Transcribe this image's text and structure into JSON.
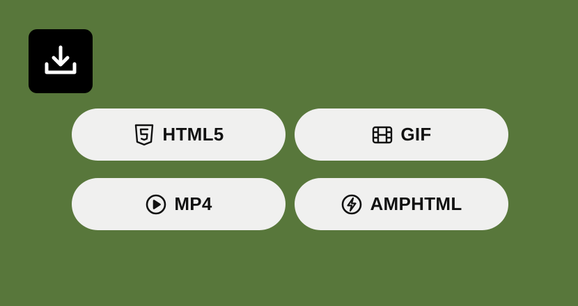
{
  "background_color": "#58773b",
  "download": {
    "icon": "download-icon",
    "tile_color": "#000000"
  },
  "formats": [
    {
      "label": "HTML5",
      "icon": "html5-icon"
    },
    {
      "label": "GIF",
      "icon": "film-icon"
    },
    {
      "label": "MP4",
      "icon": "play-circle-icon"
    },
    {
      "label": "AMPHTML",
      "icon": "lightning-circle-icon"
    }
  ],
  "button_color": "#f0f0ef",
  "text_color": "#111111"
}
